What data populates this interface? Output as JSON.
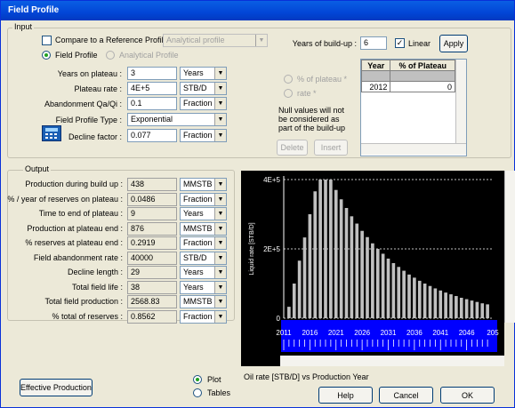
{
  "window": {
    "title": "Field Profile"
  },
  "input": {
    "group_label": "Input",
    "compare_label": "Compare to a Reference Profile",
    "reference_combo": "Analytical profile",
    "field_profile_radio": "Field Profile",
    "analytical_profile_radio": "Analytical Profile",
    "years_on_plateau_label": "Years on plateau :",
    "years_on_plateau_value": "3",
    "years_on_plateau_unit": "Years",
    "plateau_rate_label": "Plateau rate :",
    "plateau_rate_value": "4E+5",
    "plateau_rate_unit": "STB/D",
    "abandonment_label": "Abandonment Qa/Qi :",
    "abandonment_value": "0.1",
    "abandonment_unit": "Fraction",
    "field_profile_type_label": "Field Profile Type :",
    "field_profile_type_value": "Exponential",
    "decline_factor_label": "Decline factor :",
    "decline_factor_value": "0.077",
    "decline_factor_unit": "Fraction",
    "years_buildup_label": "Years of build-up :",
    "years_buildup_value": "6",
    "linear_label": "Linear",
    "apply_label": "Apply",
    "pct_plateau_radio": "% of plateau *",
    "rate_radio": "rate *",
    "null_note": "Null values will not be considered as part of the build-up",
    "delete_label": "Delete",
    "insert_label": "Insert",
    "table": {
      "headers": [
        "Year",
        "% of Plateau"
      ],
      "rows": [
        [
          "2012",
          "0"
        ]
      ]
    }
  },
  "output": {
    "group_label": "Output",
    "rows": [
      {
        "label": "Production during build up :",
        "value": "438",
        "unit": "MMSTB"
      },
      {
        "label": "% / year of reserves on plateau :",
        "value": "0.0486",
        "unit": "Fraction"
      },
      {
        "label": "Time to end of plateau :",
        "value": "9",
        "unit": "Years"
      },
      {
        "label": "Production at plateau end :",
        "value": "876",
        "unit": "MMSTB"
      },
      {
        "label": "% reserves at plateau end :",
        "value": "0.2919",
        "unit": "Fraction"
      },
      {
        "label": "Field abandonment rate :",
        "value": "40000",
        "unit": "STB/D"
      },
      {
        "label": "Decline length :",
        "value": "29",
        "unit": "Years"
      },
      {
        "label": "Total field life :",
        "value": "38",
        "unit": "Years"
      },
      {
        "label": "Total field production :",
        "value": "2568.83",
        "unit": "MMSTB"
      },
      {
        "label": "% total of reserves :",
        "value": "0.8562",
        "unit": "Fraction"
      }
    ]
  },
  "chart_caption": "Oil rate [STB/D] vs Production Year",
  "chart_data": {
    "type": "bar",
    "ylabel": "Liquid rate [STB/D]",
    "ylim": [
      0,
      400000
    ],
    "ytick_labels": [
      "4E+5",
      "2E+5",
      "0"
    ],
    "xtick_labels": [
      "2011",
      "2016",
      "2021",
      "2026",
      "2031",
      "2036",
      "2041",
      "2046",
      "205"
    ],
    "x": [
      2012,
      2013,
      2014,
      2015,
      2016,
      2017,
      2018,
      2019,
      2020,
      2021,
      2022,
      2023,
      2024,
      2025,
      2026,
      2027,
      2028,
      2029,
      2030,
      2031,
      2032,
      2033,
      2034,
      2035,
      2036,
      2037,
      2038,
      2039,
      2040,
      2041,
      2042,
      2043,
      2044,
      2045,
      2046,
      2047,
      2048,
      2049,
      2050
    ],
    "values": [
      33000,
      100000,
      166000,
      233000,
      300000,
      366000,
      400000,
      400000,
      400000,
      370000,
      343000,
      318000,
      294000,
      273000,
      252000,
      234000,
      216000,
      200000,
      186000,
      172000,
      159000,
      148000,
      137000,
      126000,
      117000,
      108000,
      100000,
      93000,
      86000,
      80000,
      74000,
      69000,
      64000,
      59000,
      55000,
      51000,
      47000,
      43000,
      40000
    ],
    "colors": {
      "background": "#000000",
      "bars": "#c0c0c0",
      "axis_band": "#0000ff"
    }
  },
  "bottom": {
    "effective_production_label": "Effective Production",
    "plot_radio": "Plot",
    "tables_radio": "Tables",
    "help_label": "Help",
    "cancel_label": "Cancel",
    "ok_label": "OK"
  }
}
